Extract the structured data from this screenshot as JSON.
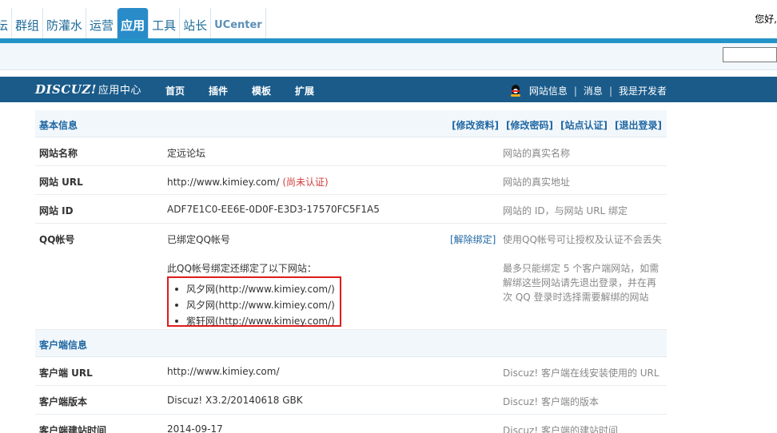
{
  "top_nav": {
    "tabs": [
      {
        "label": "坛",
        "active": false
      },
      {
        "label": "群组",
        "active": false
      },
      {
        "label": "防灌水",
        "active": false
      },
      {
        "label": "运营",
        "active": false
      },
      {
        "label": "应用",
        "active": true
      },
      {
        "label": "工具",
        "active": false
      },
      {
        "label": "站长",
        "active": false
      },
      {
        "label": "UCenter",
        "active": false
      }
    ],
    "greeting": "您好,"
  },
  "app_header": {
    "logo": "DISCUZ!",
    "logo_sub": "应用中心",
    "menu": [
      "首页",
      "插件",
      "模板",
      "扩展"
    ],
    "right_links": [
      "网站信息",
      "消息",
      "我是开发者"
    ],
    "right_sep": "|"
  },
  "basic": {
    "title": "基本信息",
    "links": [
      "[修改资料]",
      "[修改密码]",
      "[站点认证]",
      "[退出登录]"
    ],
    "rows": [
      {
        "key": "网站名称",
        "value": "定远论坛",
        "desc": "网站的真实名称"
      },
      {
        "key": "网站 URL",
        "value": "http://www.kimiey.com/",
        "badge": "(尚未认证)",
        "desc": "网站的真实地址"
      },
      {
        "key": "网站 ID",
        "value": "ADF7E1C0-EE6E-0D0F-E3D3-17570FC5F1A5",
        "desc": "网站的 ID，与网站 URL 绑定"
      }
    ],
    "qq": {
      "key": "QQ帐号",
      "value": "已绑定QQ帐号",
      "unbind": "[解除绑定]",
      "desc": "使用QQ帐号可让授权及认证不会丢失",
      "bound_intro": "此QQ帐号绑定还绑定了以下网站：",
      "bound_sites": [
        "风夕网(http://www.kimiey.com/)",
        "风夕网(http://www.kimiey.com/)",
        "紫轩网(http://www.kimiey.com/)"
      ],
      "desc2": "最多只能绑定 5 个客户端网站，如需解绑这些网站请先退出登录，并在再次 QQ 登录时选择需要解绑的网站"
    }
  },
  "client": {
    "title": "客户端信息",
    "rows": [
      {
        "key": "客户端 URL",
        "value": "http://www.kimiey.com/",
        "desc": "Discuz! 客户端在线安装使用的 URL"
      },
      {
        "key": "客户端版本",
        "value": "Discuz! X3.2/20140618 GBK",
        "desc": "Discuz! 客户端的版本"
      },
      {
        "key": "客户端建站时间",
        "value": "2014-09-17",
        "desc": "Discuz! 客户端的建站时间"
      }
    ]
  },
  "colors": {
    "accent": "#2493c7",
    "header_bg": "#1a5b8a",
    "highlight": "#e01b1b",
    "link": "#2068a3"
  }
}
